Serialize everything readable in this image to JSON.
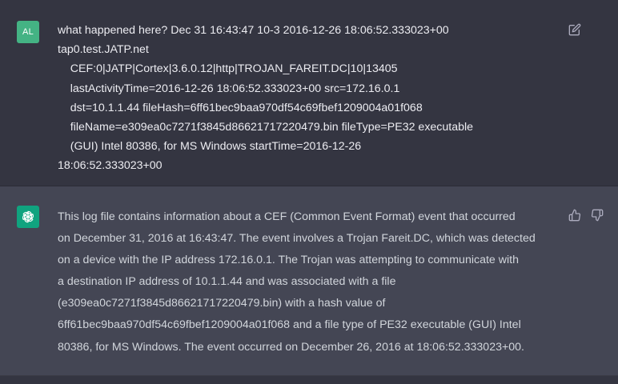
{
  "user_message": {
    "avatar_initials": "AL",
    "avatar_color": "#44b384",
    "text": "what happened here? Dec 31 16:43:47 10-3 2016-12-26 18:06:52.333023+00\ntap0.test.JATP.net\n    CEF:0|JATP|Cortex|3.6.0.12|http|TROJAN_FAREIT.DC|10|13405\n    lastActivityTime=2016-12-26 18:06:52.333023+00 src=172.16.0.1\n    dst=10.1.1.44 fileHash=6ff61bec9baa970df54c69fbef1209004a01f068\n    fileName=e309ea0c7271f3845d86621717220479.bin fileType=PE32 executable\n    (GUI) Intel 80386, for MS Windows startTime=2016-12-26\n18:06:52.333023+00",
    "edit_icon": "pencil-square-icon"
  },
  "assistant_message": {
    "avatar_icon": "openai-logo-icon",
    "avatar_color": "#10a37f",
    "text": "This log file contains information about a CEF (Common Event Format) event that occurred\non December 31, 2016 at 16:43:47. The event involves a Trojan Fareit.DC, which was detected\non a device with the IP address 172.16.0.1. The Trojan was attempting to communicate with\na destination IP address of 10.1.1.44 and was associated with a file\n(e309ea0c7271f3845d86621717220479.bin) with a hash value of\n6ff61bec9baa970df54c69fbef1209004a01f068 and a file type of PE32 executable (GUI) Intel\n80386, for MS Windows. The event occurred on December 26, 2016 at 18:06:52.333023+00.",
    "thumbs_up_icon": "thumbs-up-icon",
    "thumbs_down_icon": "thumbs-down-icon"
  },
  "colors": {
    "user_bg": "#343541",
    "assistant_bg": "#444654",
    "user_text": "#ececf1",
    "assistant_text": "#d1d5db",
    "icon_color": "#acacbe"
  }
}
